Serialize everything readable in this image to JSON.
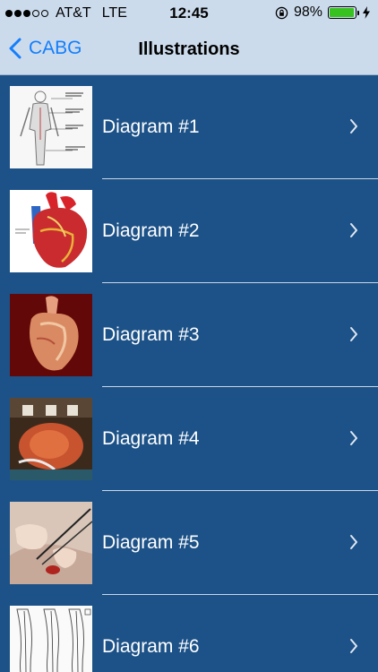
{
  "status_bar": {
    "carrier": "AT&T",
    "network": "LTE",
    "time": "12:45",
    "battery_percent": "98%",
    "battery_level": 0.98,
    "signal_bars_filled": 3,
    "signal_bars_total": 5
  },
  "nav": {
    "back_label": "CABG",
    "title": "Illustrations"
  },
  "diagrams": [
    {
      "label": "Diagram #1",
      "thumb_icon": "anatomy-vessels-illustration"
    },
    {
      "label": "Diagram #2",
      "thumb_icon": "heart-bypass-illustration"
    },
    {
      "label": "Diagram #3",
      "thumb_icon": "heart-photo"
    },
    {
      "label": "Diagram #4",
      "thumb_icon": "surgery-photo"
    },
    {
      "label": "Diagram #5",
      "thumb_icon": "suture-photo"
    },
    {
      "label": "Diagram #6",
      "thumb_icon": "leg-vein-illustration"
    }
  ],
  "colors": {
    "bar_background": "#ccdbec",
    "list_background": "#1d5288",
    "accent": "#147efb",
    "battery": "#38c21f"
  }
}
